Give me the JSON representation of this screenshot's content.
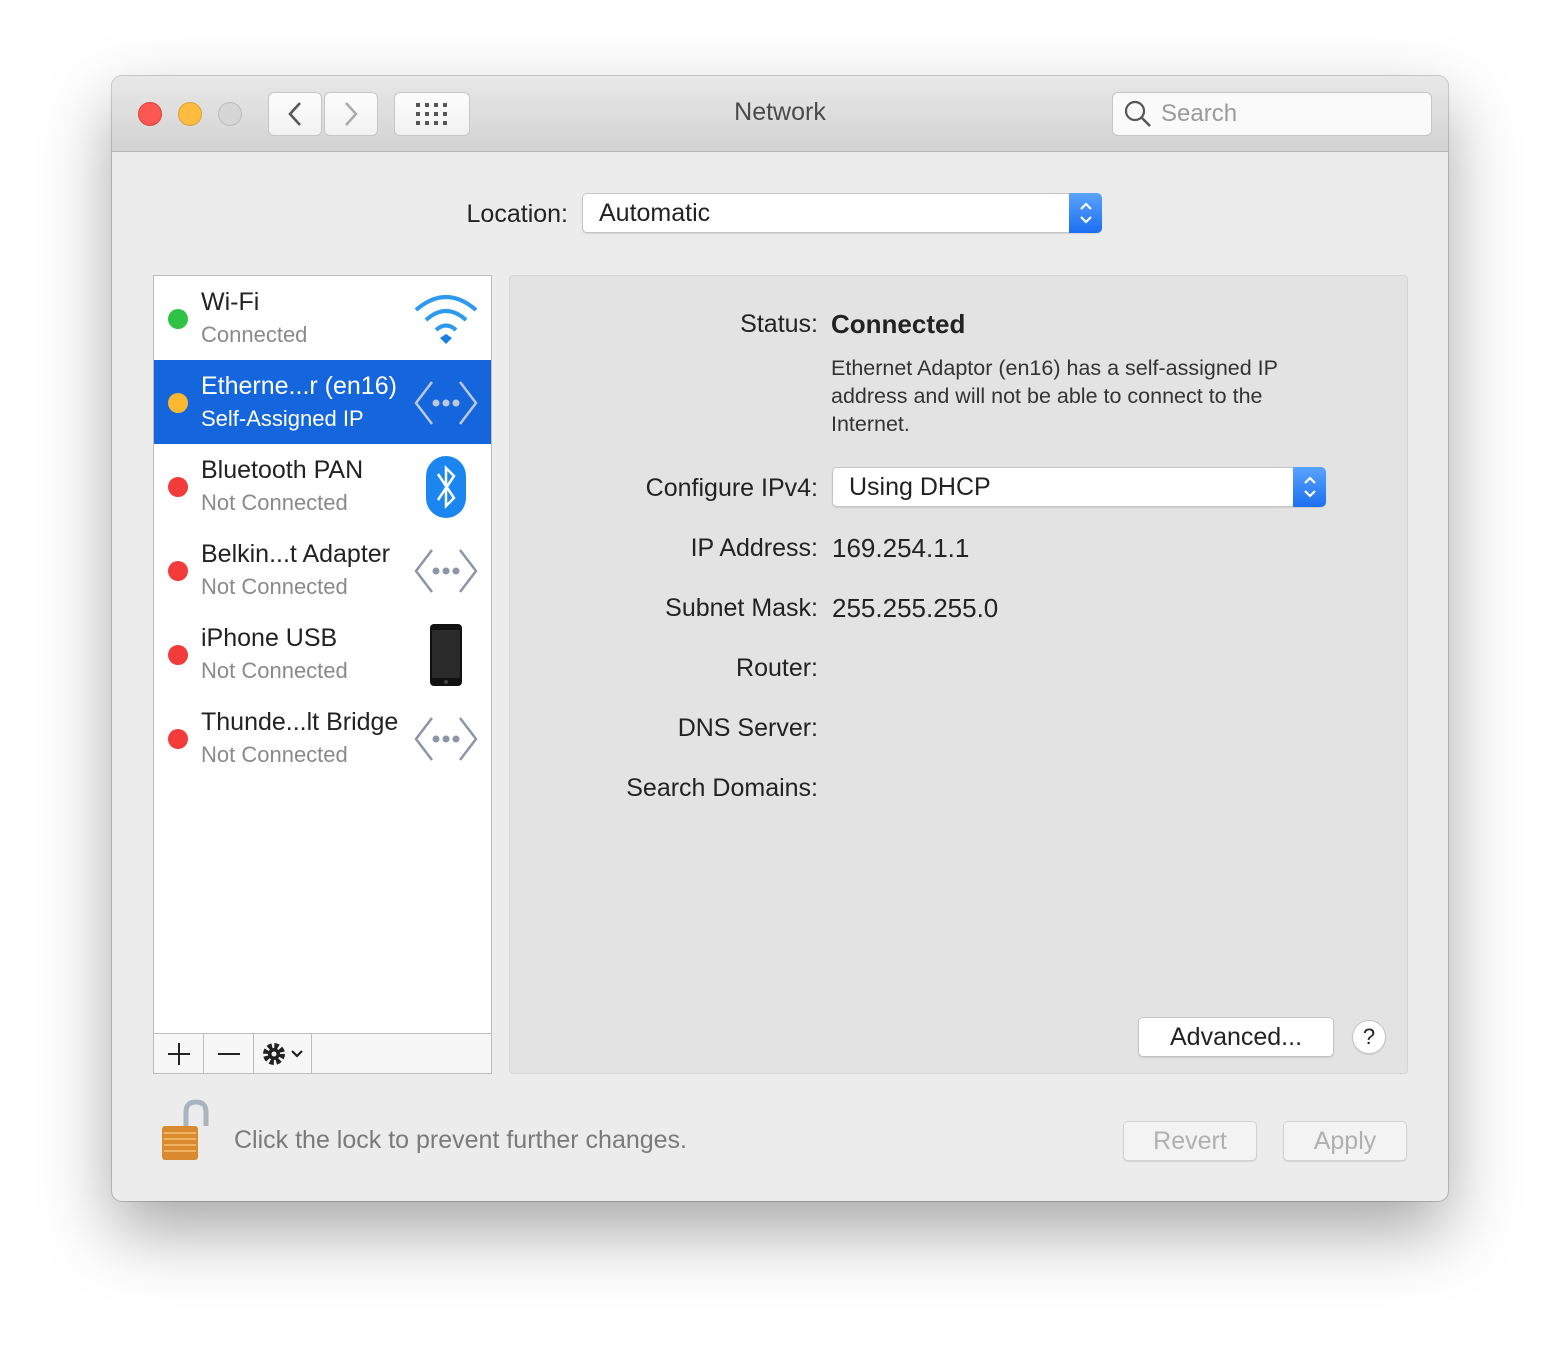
{
  "window": {
    "title": "Network"
  },
  "toolbar": {
    "search_placeholder": "Search"
  },
  "location": {
    "label": "Location:",
    "value": "Automatic"
  },
  "services": [
    {
      "name": "Wi-Fi",
      "status": "Connected",
      "status_color": "#2fc244",
      "icon": "wifi-icon",
      "selected": false
    },
    {
      "name": "Etherne...r (en16)",
      "status": "Self-Assigned IP",
      "status_color": "#fcb82e",
      "icon": "ethernet-icon",
      "selected": true
    },
    {
      "name": "Bluetooth PAN",
      "status": "Not Connected",
      "status_color": "#f23b3b",
      "icon": "bluetooth-icon",
      "selected": false
    },
    {
      "name": "Belkin...t Adapter",
      "status": "Not Connected",
      "status_color": "#f23b3b",
      "icon": "ethernet-icon",
      "selected": false
    },
    {
      "name": "iPhone USB",
      "status": "Not Connected",
      "status_color": "#f23b3b",
      "icon": "iphone-icon",
      "selected": false
    },
    {
      "name": "Thunde...lt Bridge",
      "status": "Not Connected",
      "status_color": "#f23b3b",
      "icon": "ethernet-icon",
      "selected": false
    }
  ],
  "detail": {
    "status_label": "Status:",
    "status_value": "Connected",
    "status_desc": "Ethernet Adaptor (en16) has a self-assigned IP address and will not be able to connect to the Internet.",
    "configure_label": "Configure IPv4:",
    "configure_value": "Using DHCP",
    "ip_label": "IP Address:",
    "ip_value": "169.254.1.1",
    "subnet_label": "Subnet Mask:",
    "subnet_value": "255.255.255.0",
    "router_label": "Router:",
    "dns_label": "DNS Server:",
    "domains_label": "Search Domains:",
    "advanced": "Advanced...",
    "help": "?"
  },
  "footer": {
    "lock_text": "Click the lock to prevent further changes.",
    "revert": "Revert",
    "apply": "Apply"
  },
  "colors": {
    "accent": "#1565dc",
    "close": "#fc5753",
    "minimize": "#fdbc40"
  }
}
